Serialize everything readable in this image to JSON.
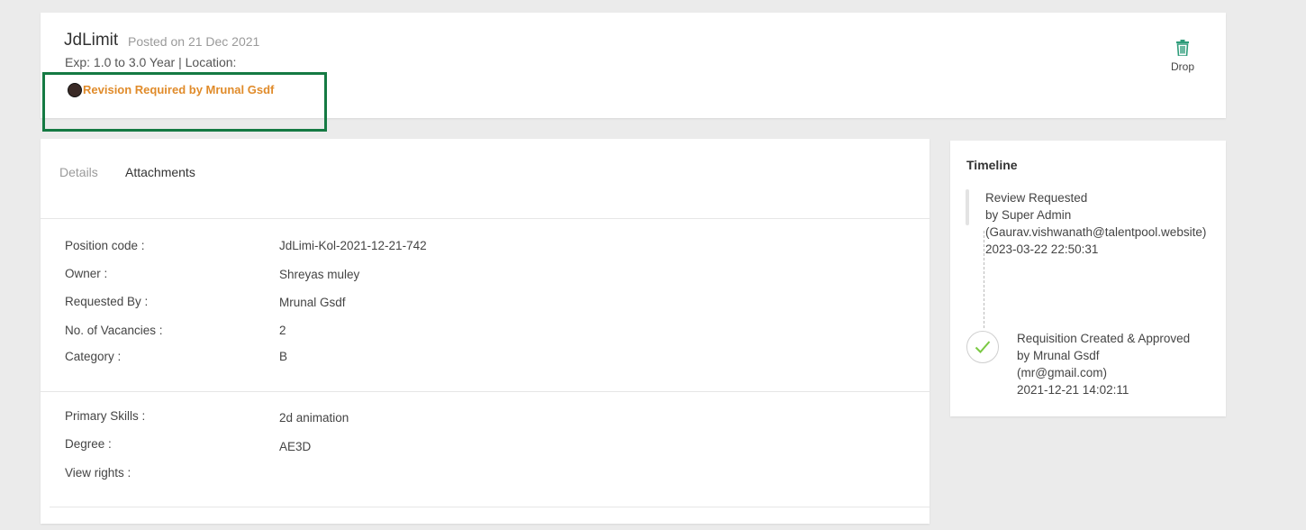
{
  "header": {
    "title": "JdLimit",
    "posted_on": "Posted on 21 Dec 2021",
    "meta": "Exp: 1.0 to 3.0 Year | Location:",
    "revision_status": "Revision Required by Mrunal Gsdf",
    "drop_label": "Drop",
    "drop_icon": "trash-icon",
    "colors": {
      "revision": "#e08b2a",
      "drop_icon": "#2e9c7a",
      "highlight_box": "#157a43"
    }
  },
  "tabs": [
    {
      "label": "Details",
      "active": false
    },
    {
      "label": "Attachments",
      "active": true
    }
  ],
  "details": {
    "section1": [
      {
        "label": "Position code :",
        "value": "JdLimi-Kol-2021-12-21-742"
      },
      {
        "label": "Owner :",
        "value": "Shreyas muley"
      },
      {
        "label": "Requested By :",
        "value": "Mrunal Gsdf"
      },
      {
        "label": "No. of Vacancies :",
        "value": "2"
      },
      {
        "label": "Category :",
        "value": "B"
      }
    ],
    "section2": [
      {
        "label": "Primary Skills :",
        "value": "2d animation"
      },
      {
        "label": "Degree :",
        "value": "AE3D"
      },
      {
        "label": "View rights :",
        "value": ""
      }
    ]
  },
  "timeline": {
    "title": "Timeline",
    "events": [
      {
        "action": "Review Requested",
        "by": "by Super Admin",
        "email": "(Gaurav.vishwanath@talentpool.website)",
        "timestamp": "2023-03-22 22:50:31",
        "icon": "pending-bar"
      },
      {
        "action": "Requisition Created & Approved",
        "by": "by Mrunal Gsdf",
        "email": "(mr@gmail.com)",
        "timestamp": "2021-12-21 14:02:11",
        "icon": "check-icon"
      }
    ]
  }
}
